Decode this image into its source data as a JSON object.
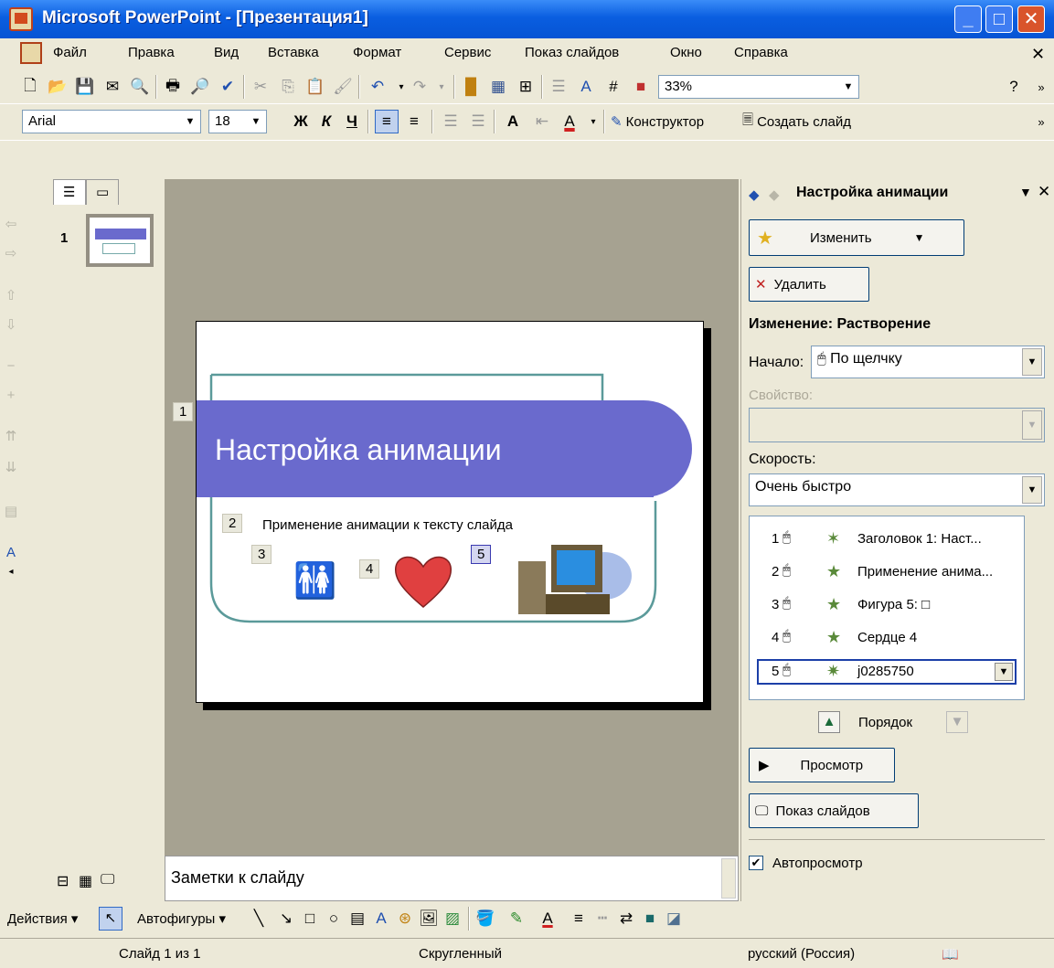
{
  "window": {
    "title": "Microsoft PowerPoint - [Презентация1]"
  },
  "menu": [
    "Файл",
    "Правка",
    "Вид",
    "Вставка",
    "Формат",
    "Сервис",
    "Показ слайдов",
    "Окно",
    "Справка"
  ],
  "toolbar": {
    "zoom": "33%",
    "font": "Arial",
    "font_size": "18",
    "bold": "Ж",
    "italic": "К",
    "underline": "Ч",
    "designer": "Конструктор",
    "new_slide": "Создать слайд"
  },
  "slides_pane": {
    "slide_number": "1"
  },
  "slide": {
    "title": "Настройка анимации",
    "subtitle": "Применение анимации к тексту слайда",
    "tags": [
      "1",
      "2",
      "3",
      "4",
      "5"
    ]
  },
  "notes": {
    "text": "Заметки к слайду"
  },
  "task_pane": {
    "title": "Настройка анимации",
    "change_button": "Изменить",
    "delete_button": "Удалить",
    "effect_heading": "Изменение: Растворение",
    "start_label": "Начало:",
    "start_value": "По щелчку",
    "property_label": "Свойство:",
    "speed_label": "Скорость:",
    "speed_value": "Очень быстро",
    "items": [
      {
        "num": "1",
        "label": "Заголовок 1: Наст..."
      },
      {
        "num": "2",
        "label": "Применение анима..."
      },
      {
        "num": "3",
        "label": "Фигура 5: □"
      },
      {
        "num": "4",
        "label": "Сердце 4"
      },
      {
        "num": "5",
        "label": "j0285750"
      }
    ],
    "order_label": "Порядок",
    "preview_button": "Просмотр",
    "slideshow_button": "Показ слайдов",
    "autopreview_label": "Автопросмотр"
  },
  "drawing": {
    "actions": "Действия",
    "autoshapes": "Автофигуры"
  },
  "status": {
    "slide": "Слайд 1 из 1",
    "design": "Скругленный",
    "language": "русский (Россия)"
  }
}
